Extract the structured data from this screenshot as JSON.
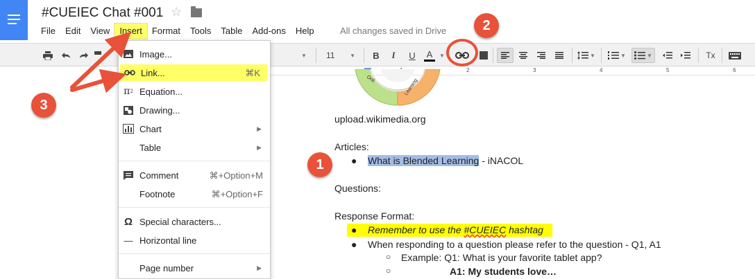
{
  "doc": {
    "title": "#CUEIEC Chat #001",
    "saved_status": "All changes saved in Drive"
  },
  "menubar": {
    "items": [
      "File",
      "Edit",
      "View",
      "Insert",
      "Format",
      "Tools",
      "Table",
      "Add-ons",
      "Help"
    ],
    "active": "Insert"
  },
  "toolbar": {
    "font_size": "11",
    "bold": "B",
    "italic": "I",
    "underline": "U",
    "text_color": "A",
    "clear_format": "Tx"
  },
  "ruler": {
    "numbers": [
      "1",
      "2",
      "3",
      "4",
      "5",
      "6"
    ]
  },
  "insert_menu": {
    "items": [
      {
        "label": "Image...",
        "shortcut": "",
        "icon": "image-icon"
      },
      {
        "label": "Link...",
        "shortcut": "⌘K",
        "icon": "link-icon",
        "highlighted": true
      },
      {
        "label": "Equation...",
        "shortcut": "",
        "icon": "pi-icon"
      },
      {
        "label": "Drawing...",
        "shortcut": "",
        "icon": "drawing-icon"
      },
      {
        "label": "Chart",
        "shortcut": "",
        "icon": "chart-icon",
        "submenu": true
      },
      {
        "label": "Table",
        "shortcut": "",
        "submenu": true
      },
      {
        "label": "Comment",
        "shortcut": "⌘+Option+M",
        "icon": "comment-icon"
      },
      {
        "label": "Footnote",
        "shortcut": "⌘+Option+F"
      },
      {
        "label": "Special characters...",
        "shortcut": "",
        "icon": "omega-icon"
      },
      {
        "label": "Horizontal line",
        "shortcut": "",
        "icon": "dash-icon"
      },
      {
        "label": "Page number",
        "shortcut": "",
        "submenu": true
      }
    ]
  },
  "content": {
    "image_source": "upload.wikimedia.org",
    "articles_heading": "Articles:",
    "article_link_text": "What is Blended Learning",
    "article_suffix": " - iNACOL",
    "questions_heading": "Questions:",
    "response_heading": "Response Format:",
    "bullet1_pre": "Remember to use the ",
    "bullet1_tag": "#CUEIEC",
    "bullet1_post": " hashtag",
    "bullet2": "When responding to a question please refer to the question - Q1, A1",
    "sub1": "Example: Q1: What is your favorite tablet app?",
    "sub2": "A1: My students love…",
    "logo_words": [
      "Onli",
      "Learning"
    ]
  },
  "annotations": {
    "badges": [
      "1",
      "2",
      "3"
    ],
    "color": "#e8523a"
  },
  "colors": {
    "docs_blue": "#4285f4",
    "selection": "#a3bde6",
    "highlight": "#ffff00",
    "menu_highlight": "#ffff66"
  }
}
